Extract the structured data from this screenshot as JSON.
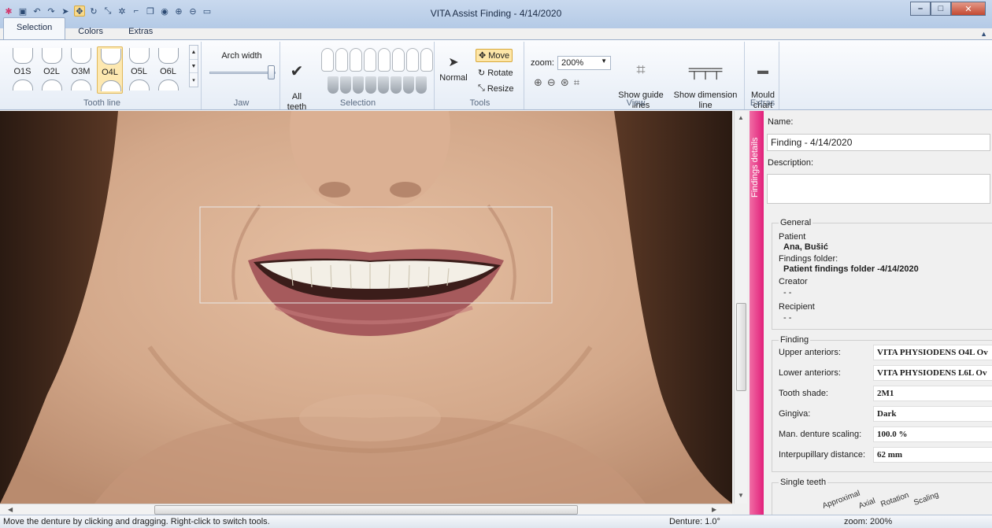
{
  "window": {
    "title": "VITA Assist Finding - 4/14/2020",
    "controls": [
      "minimize",
      "maximize",
      "close"
    ]
  },
  "quick_access": [
    "app-logo-icon",
    "save-icon",
    "undo-icon",
    "redo-icon",
    "pointer-icon",
    "move-icon",
    "rotate-icon",
    "resize-icon",
    "gear-icon",
    "brush-icon",
    "copy-icon",
    "eye-icon",
    "zoom-in-icon",
    "zoom-out-icon",
    "screen-icon"
  ],
  "tabs": [
    {
      "label": "Selection",
      "active": true
    },
    {
      "label": "Colors",
      "active": false
    },
    {
      "label": "Extras",
      "active": false
    }
  ],
  "ribbon": {
    "tooth_line": {
      "items": [
        {
          "code": "O1S",
          "selected": false
        },
        {
          "code": "O2L",
          "selected": false
        },
        {
          "code": "O3M",
          "selected": false
        },
        {
          "code": "O4L",
          "selected": true
        },
        {
          "code": "O5L",
          "selected": false
        },
        {
          "code": "O6L",
          "selected": false
        }
      ],
      "group_label": "Tooth line"
    },
    "jaw": {
      "arch_width_label": "Arch width",
      "arch_width_value": 1.0,
      "group_label": "Jaw"
    },
    "selection": {
      "all_teeth_label": "All\nteeth",
      "group_label": "Selection"
    },
    "tools": {
      "normal_label": "Normal",
      "move_label": "Move",
      "rotate_label": "Rotate",
      "resize_label": "Resize",
      "group_label": "Tools"
    },
    "view": {
      "zoom_label": "zoom:",
      "zoom_value": "200%",
      "show_guide_lines_label": "Show guide\nlines",
      "show_dimension_line_label": "Show dimension\nline",
      "group_label": "View"
    },
    "extras": {
      "mould_chart_label": "Mould\nchart",
      "group_label": "Extras"
    }
  },
  "side_tab_label": "Findings details",
  "details": {
    "name_label": "Name:",
    "name_value": "Finding - 4/14/2020",
    "description_label": "Description:",
    "description_value": "",
    "general": {
      "legend": "General",
      "patient_label": "Patient",
      "patient_value": "Ana, Bušić",
      "findings_folder_label": "Findings folder:",
      "findings_folder_value": "Patient findings folder -4/14/2020",
      "creator_label": "Creator",
      "creator_value": "- -",
      "recipient_label": "Recipient",
      "recipient_value": "- -"
    },
    "finding": {
      "legend": "Finding",
      "rows": [
        {
          "label": "Upper anteriors:",
          "value": "VITA PHYSIODENS  O4L  Ov"
        },
        {
          "label": "Lower anteriors:",
          "value": "VITA PHYSIODENS  L6L  Ov"
        },
        {
          "label": "Tooth shade:",
          "value": "2M1"
        },
        {
          "label": "Gingiva:",
          "value": "Dark"
        },
        {
          "label": "Man. denture scaling:",
          "value": "100.0 %"
        },
        {
          "label": "Interpupillary distance:",
          "value": "62   mm"
        }
      ]
    },
    "single_teeth": {
      "legend": "Single teeth",
      "columns": [
        "Approximal",
        "Axial",
        "Rotation",
        "Scaling"
      ]
    }
  },
  "status": {
    "hint": "Move the denture by clicking and dragging. Right-click to switch tools.",
    "denture": "Denture: 1.0°",
    "zoom": "zoom: 200%"
  },
  "colors": {
    "accent_pink": "#e2207a",
    "selected_tool": "#fde6a8",
    "ribbon_bg": "#eef3f9"
  }
}
